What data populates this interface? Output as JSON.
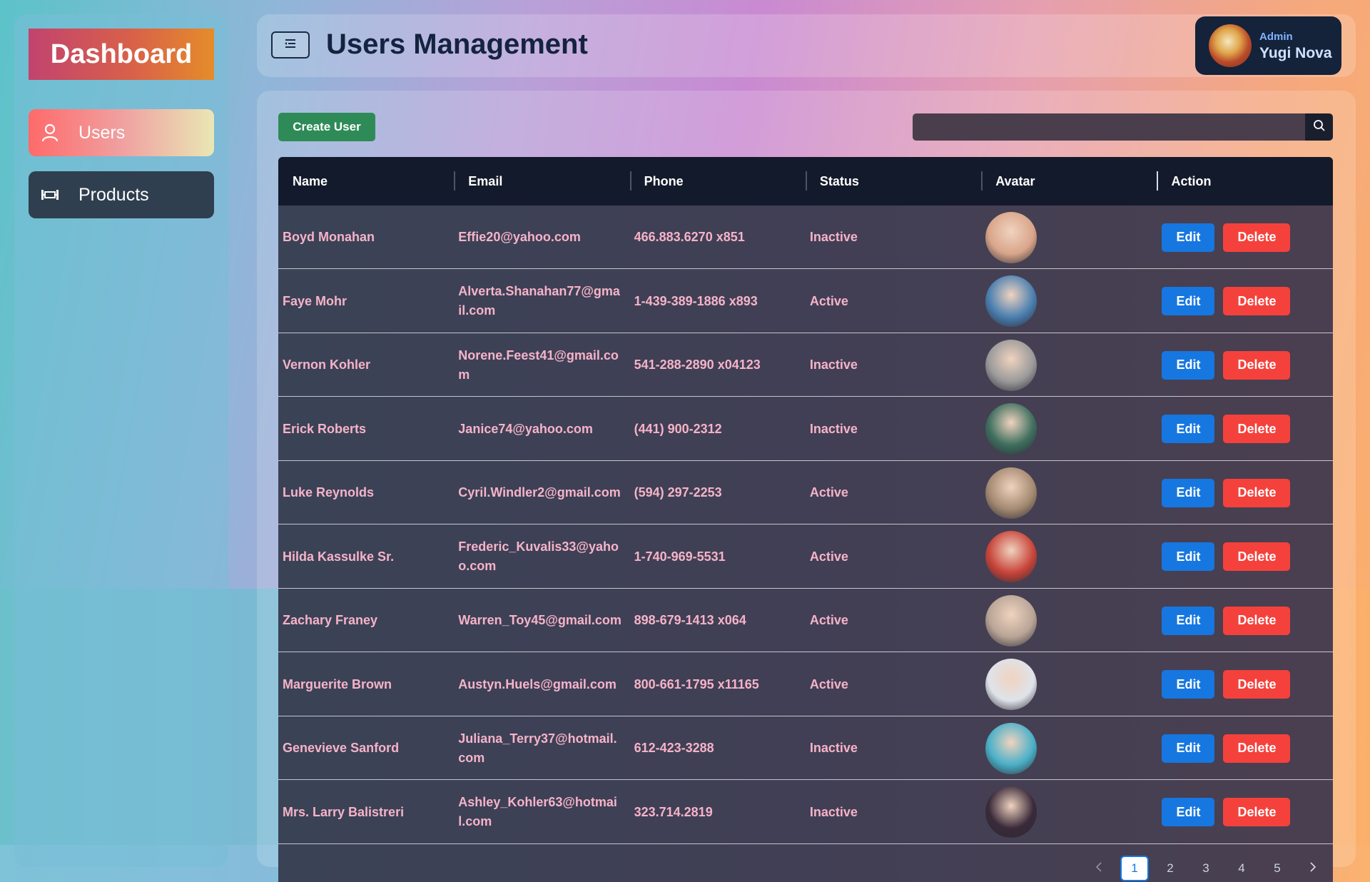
{
  "sidebar": {
    "brand": "Dashboard",
    "items": [
      {
        "label": "Users",
        "icon": "user-icon",
        "active": true
      },
      {
        "label": "Products",
        "icon": "product-icon",
        "active": false
      }
    ]
  },
  "header": {
    "title": "Users Management",
    "menu_icon": "menu-toggle-icon",
    "profile": {
      "role": "Admin",
      "name": "Yugi Nova"
    }
  },
  "toolbar": {
    "create_label": "Create User",
    "search_placeholder": "",
    "search_icon": "search-icon"
  },
  "table": {
    "columns": [
      "Name",
      "Email",
      "Phone",
      "Status",
      "Avatar",
      "Action"
    ],
    "rows": [
      {
        "name": "Boyd Monahan",
        "email": "Effie20@yahoo.com",
        "phone": "466.883.6270 x851",
        "status": "Inactive",
        "avatar_color": "#d9a58a"
      },
      {
        "name": "Faye Mohr",
        "email": "Alverta.Shanahan77@gmail.com",
        "phone": "1-439-389-1886 x893",
        "status": "Active",
        "avatar_color": "#4a7fb0"
      },
      {
        "name": "Vernon Kohler",
        "email": "Norene.Feest41@gmail.com",
        "phone": "541-288-2890 x04123",
        "status": "Inactive",
        "avatar_color": "#9a9a9a"
      },
      {
        "name": "Erick Roberts",
        "email": "Janice74@yahoo.com",
        "phone": "(441) 900-2312",
        "status": "Inactive",
        "avatar_color": "#3e6e5e"
      },
      {
        "name": "Luke Reynolds",
        "email": "Cyril.Windler2@gmail.com",
        "phone": "(594) 297-2253",
        "status": "Active",
        "avatar_color": "#a58a72"
      },
      {
        "name": "Hilda Kassulke Sr.",
        "email": "Frederic_Kuvalis33@yahoo.com",
        "phone": "1-740-969-5531",
        "status": "Active",
        "avatar_color": "#c8443a"
      },
      {
        "name": "Zachary Franey",
        "email": "Warren_Toy45@gmail.com",
        "phone": "898-679-1413 x064",
        "status": "Active",
        "avatar_color": "#b8a496"
      },
      {
        "name": "Marguerite Brown",
        "email": "Austyn.Huels@gmail.com",
        "phone": "800-661-1795 x11165",
        "status": "Active",
        "avatar_color": "#dfe3ea"
      },
      {
        "name": "Genevieve Sanford",
        "email": "Juliana_Terry37@hotmail.com",
        "phone": "612-423-3288",
        "status": "Inactive",
        "avatar_color": "#4ab0c8"
      },
      {
        "name": "Mrs. Larry Balistreri",
        "email": "Ashley_Kohler63@hotmail.com",
        "phone": "323.714.2819",
        "status": "Inactive",
        "avatar_color": "#3a2a3a"
      }
    ],
    "edit_label": "Edit",
    "delete_label": "Delete"
  },
  "pagination": {
    "prev_icon": "chevron-left-icon",
    "next_icon": "chevron-right-icon",
    "pages": [
      "1",
      "2",
      "3",
      "4",
      "5"
    ],
    "current": "1"
  },
  "colors": {
    "edit": "#1677e0",
    "delete": "#f5413c",
    "create": "#2e8b57",
    "row_text": "#f6b3c8"
  }
}
